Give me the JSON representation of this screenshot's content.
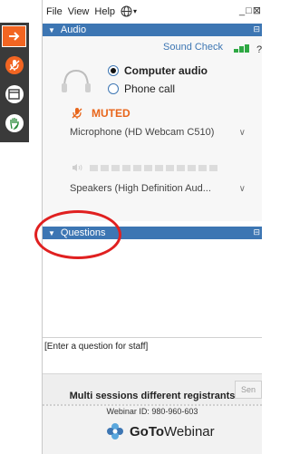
{
  "menubar": {
    "items": [
      "File",
      "View",
      "Help"
    ],
    "globe_icon": "globe-icon",
    "window_controls": "_□⊠",
    "window_extra": "×"
  },
  "left_toolbar": {
    "buttons": [
      {
        "icon": "arrow-right-icon",
        "color": "#f26522"
      },
      {
        "icon": "microphone-muted-icon",
        "color": "#f26522"
      },
      {
        "icon": "window-icon",
        "color": "#ffffff"
      },
      {
        "icon": "hand-raise-icon",
        "color": "#ffffff"
      }
    ]
  },
  "audio": {
    "header": "Audio",
    "sound_check": "Sound Check",
    "help": "?",
    "options": [
      {
        "label": "Computer audio",
        "selected": true
      },
      {
        "label": "Phone call",
        "selected": false
      }
    ],
    "muted_label": "MUTED",
    "microphone": "Microphone (HD Webcam C510)",
    "speakers": "Speakers (High Definition Aud...",
    "signal_strength": 3
  },
  "questions": {
    "header": "Questions",
    "input_placeholder": "[Enter a question for staff]",
    "send_label": "Sen"
  },
  "footer": {
    "session_title": "Multi sessions different registrants",
    "webinar_id": "Webinar ID: 980-960-603",
    "brand_bold": "GoTo",
    "brand_rest": "Webinar"
  },
  "colors": {
    "accent_blue": "#3d76b3",
    "muted_orange": "#e8661b",
    "annotation_red": "#e02020"
  }
}
